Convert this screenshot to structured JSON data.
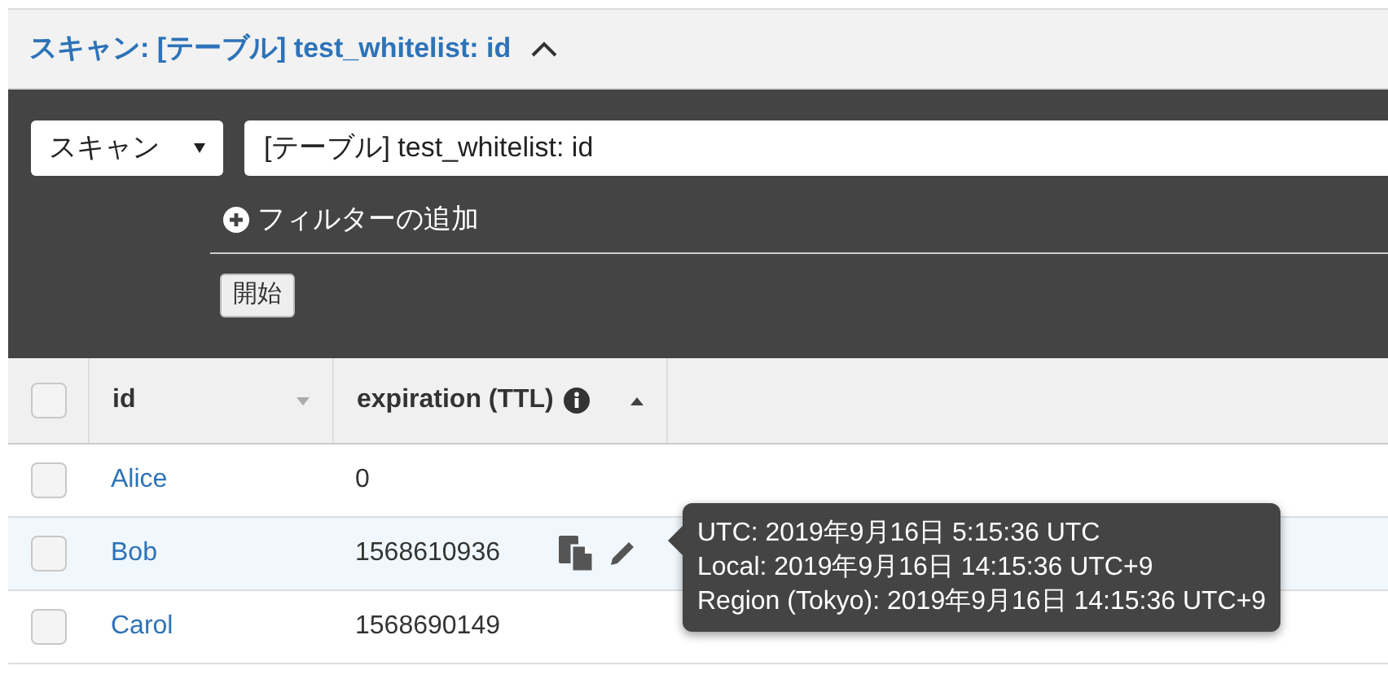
{
  "header": {
    "title": "スキャン: [テーブル] test_whitelist: id",
    "expanded": true
  },
  "query": {
    "mode": "スキャン",
    "target": "[テーブル] test_whitelist: id",
    "add_filter": "フィルターの追加",
    "start_button": "開始"
  },
  "table": {
    "select_all": {
      "checked": false
    },
    "columns": [
      {
        "label": "id",
        "sorted": false,
        "info": false
      },
      {
        "label": "expiration (TTL)",
        "sorted": true,
        "info": true
      }
    ],
    "rows": [
      {
        "checked": false,
        "selected": false,
        "id": "Alice",
        "expiration": "0"
      },
      {
        "checked": false,
        "selected": true,
        "id": "Bob",
        "expiration": "1568610936"
      },
      {
        "checked": false,
        "selected": false,
        "id": "Carol",
        "expiration": "1568690149"
      }
    ]
  },
  "tooltip": {
    "lines": [
      "UTC: 2019年9月16日 5:15:36 UTC",
      "Local: 2019年9月16日 14:15:36 UTC+9",
      "Region (Tokyo): 2019年9月16日 14:15:36 UTC+9"
    ]
  }
}
